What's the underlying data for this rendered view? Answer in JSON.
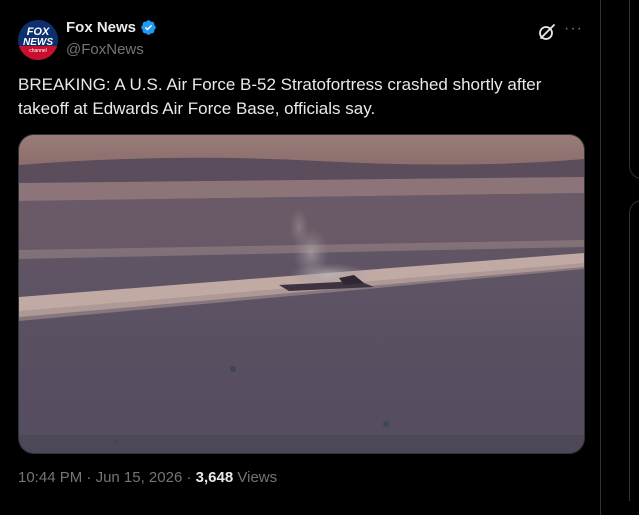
{
  "author": {
    "display_name": "Fox News",
    "handle": "@FoxNews",
    "avatar_text_top": "FOX",
    "avatar_text_mid": "NEWS",
    "avatar_text_bottom": "channel",
    "verified_icon": "verified-badge-icon"
  },
  "header_actions": {
    "grok_icon": "grok-icon",
    "more_icon": "more-options-icon",
    "more_glyph": "···"
  },
  "tweet": {
    "text": "BREAKING: A U.S. Air Force B-52 Stratofortress crashed shortly after takeoff at Edwards Air Force Base, officials say."
  },
  "media": {
    "type": "photo",
    "description_icon": "crash-site-photo"
  },
  "meta": {
    "time": "10:44 PM",
    "separator": "·",
    "date": "Jun 15, 2026",
    "views_count": "3,648",
    "views_label": "Views"
  },
  "colors": {
    "background": "#000000",
    "text_primary": "#e7e9ea",
    "text_secondary": "#71767b",
    "verified_blue": "#1d9bf0",
    "border": "#2f3336"
  }
}
